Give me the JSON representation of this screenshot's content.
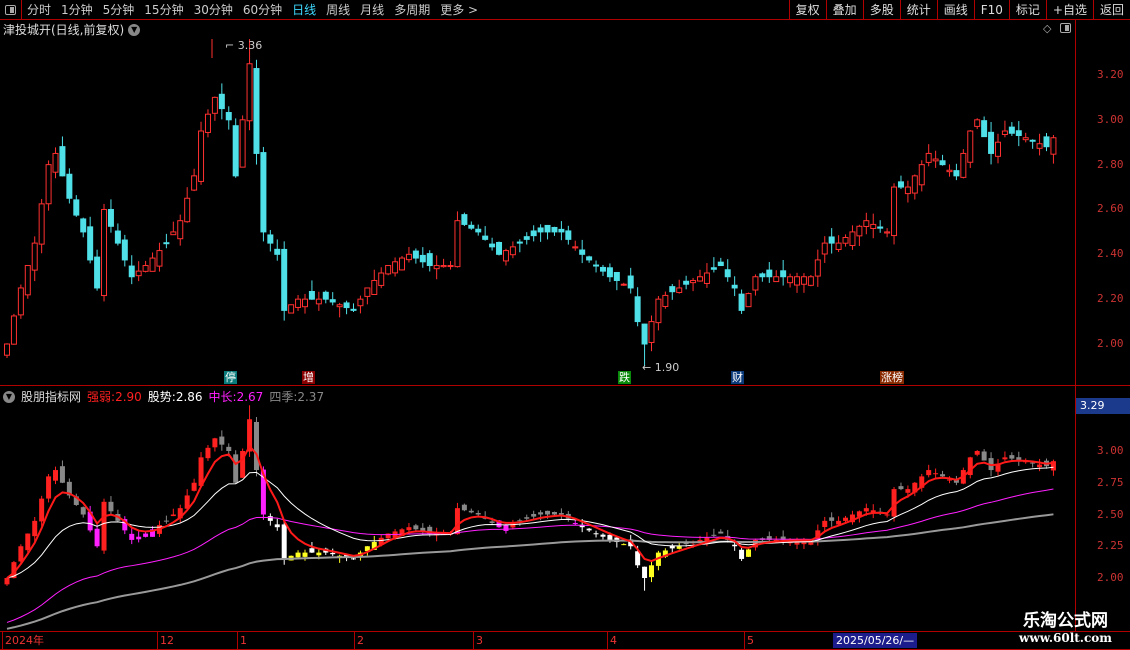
{
  "toolbar": {
    "periods": [
      "分时",
      "1分钟",
      "5分钟",
      "15分钟",
      "30分钟",
      "60分钟",
      "日线",
      "周线",
      "月线",
      "多周期",
      "更多 >"
    ],
    "active": "日线",
    "right_buttons": [
      "复权",
      "叠加",
      "多股",
      "统计",
      "画线",
      "F10",
      "标记",
      "+自选",
      "返回"
    ]
  },
  "title": "津投城开(日线,前复权)",
  "upper_axis": [
    "3.20",
    "3.00",
    "2.80",
    "2.60",
    "2.40",
    "2.20",
    "2.00"
  ],
  "high_label": "3.36",
  "low_label": "1.90",
  "events": [
    {
      "t": "停",
      "c": "#0a7a7a"
    },
    {
      "t": "增",
      "c": "#8a0000"
    },
    {
      "t": "跌",
      "c": "#0a8a0a"
    },
    {
      "t": "财",
      "c": "#0a3a7a"
    },
    {
      "t": "涨榜",
      "c": "#8a2a00"
    }
  ],
  "indicator": {
    "name": "股朋指标网",
    "items": [
      {
        "label": "强弱:",
        "value": "2.90",
        "color": "#ff2020"
      },
      {
        "label": "股势:",
        "value": "2.86",
        "color": "#ffffff"
      },
      {
        "label": "中长:",
        "value": "2.67",
        "color": "#ff20ff"
      },
      {
        "label": "四季:",
        "value": "2.37",
        "color": "#888888"
      }
    ]
  },
  "lower_axis": [
    "3.00",
    "2.75",
    "2.50",
    "2.25",
    "2.00"
  ],
  "lower_current": "3.29",
  "dates": [
    "2024年",
    "12",
    "1",
    "2",
    "3",
    "4",
    "5"
  ],
  "current_date": "2025/05/26/—",
  "watermark": {
    "name": "乐淘公式网",
    "url": "www.60lt.com"
  },
  "chart_data": {
    "type": "candlestick",
    "ylim_upper": [
      1.9,
      3.4
    ],
    "ylim_lower": [
      1.9,
      3.2
    ],
    "anchors": [
      [
        0,
        2.0
      ],
      [
        2,
        2.25
      ],
      [
        4,
        2.45
      ],
      [
        6,
        2.8
      ],
      [
        7,
        2.85
      ],
      [
        9,
        2.65
      ],
      [
        11,
        2.5
      ],
      [
        13,
        2.25
      ],
      [
        14,
        2.6
      ],
      [
        16,
        2.45
      ],
      [
        18,
        2.3
      ],
      [
        20,
        2.35
      ],
      [
        23,
        2.45
      ],
      [
        25,
        2.55
      ],
      [
        27,
        2.75
      ],
      [
        28,
        2.95
      ],
      [
        30,
        3.1
      ],
      [
        32,
        3.0
      ],
      [
        33,
        2.75
      ],
      [
        35,
        3.25
      ],
      [
        36,
        2.85
      ],
      [
        37,
        2.5
      ],
      [
        39,
        2.4
      ],
      [
        40,
        2.15
      ],
      [
        42,
        2.2
      ],
      [
        46,
        2.2
      ],
      [
        50,
        2.15
      ],
      [
        52,
        2.25
      ],
      [
        55,
        2.35
      ],
      [
        58,
        2.4
      ],
      [
        61,
        2.35
      ],
      [
        64,
        2.35
      ],
      [
        65,
        2.55
      ],
      [
        68,
        2.5
      ],
      [
        71,
        2.4
      ],
      [
        74,
        2.45
      ],
      [
        77,
        2.5
      ],
      [
        80,
        2.5
      ],
      [
        83,
        2.4
      ],
      [
        87,
        2.3
      ],
      [
        90,
        2.25
      ],
      [
        91,
        2.1
      ],
      [
        92,
        2.0
      ],
      [
        94,
        2.2
      ],
      [
        97,
        2.25
      ],
      [
        100,
        2.3
      ],
      [
        103,
        2.35
      ],
      [
        105,
        2.25
      ],
      [
        106,
        2.15
      ],
      [
        108,
        2.3
      ],
      [
        111,
        2.3
      ],
      [
        116,
        2.3
      ],
      [
        118,
        2.45
      ],
      [
        120,
        2.45
      ],
      [
        122,
        2.5
      ],
      [
        124,
        2.55
      ],
      [
        127,
        2.5
      ],
      [
        128,
        2.7
      ],
      [
        130,
        2.7
      ],
      [
        133,
        2.85
      ],
      [
        135,
        2.8
      ],
      [
        137,
        2.75
      ],
      [
        139,
        2.95
      ],
      [
        140,
        3.0
      ],
      [
        142,
        2.85
      ],
      [
        144,
        2.95
      ],
      [
        147,
        2.92
      ],
      [
        150,
        2.88
      ],
      [
        151,
        2.92
      ]
    ]
  }
}
